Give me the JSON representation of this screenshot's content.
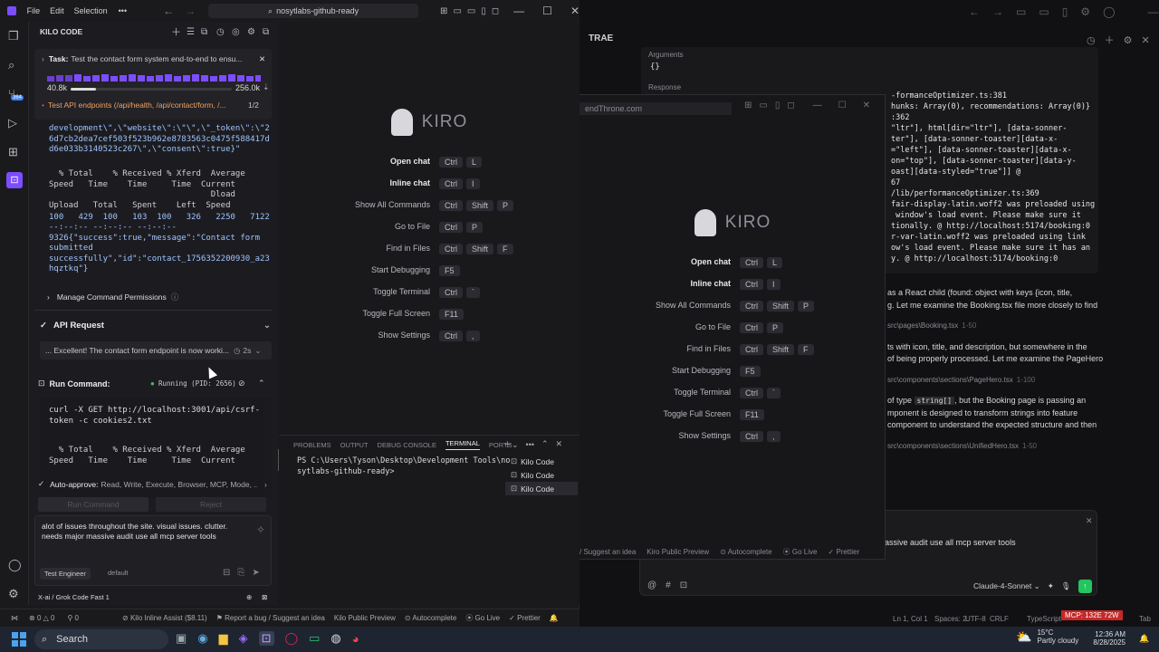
{
  "titlebar": {
    "menu": [
      "File",
      "Edit",
      "Selection"
    ],
    "more": "•••",
    "search": "nosytlabs-github-ready"
  },
  "kilo": {
    "header": "KILO CODE",
    "task_label": "Task:",
    "task_text": "Test the contact form system end-to-end to ensu...",
    "tokens_in": "40.8k",
    "tokens_max": "256.0k",
    "context_fraction": 0.16,
    "test_title": "Test API endpoints (/api/health, /api/contact/form, /...",
    "test_page": "1/2",
    "code1": "development\\\",\\\"website\\\":\\\"\\\",\\\"_token\\\":\\\"2\n6d7cb2dea7cef503f523b962e8783563c0475f588417d\nd6e033b3140523c267\\\",\\\"consent\\\":true}\"",
    "curl_hdr1": "  % Total    % Received % Xferd  Average\nSpeed   Time    Time     Time  Current\n                                 Dload\nUpload   Total   Spent    Left  Speed",
    "curl_stats": "100   429  100   103  100   326   2250   7122",
    "curl_body": "--:--:-- --:--:-- --:--:--\n9326{\"success\":true,\"message\":\"Contact form\nsubmitted\nsuccessfully\",\"id\":\"contact_1756352200930_a23\nhqztkq\"}",
    "manage_perms": "Manage Command Permissions",
    "api_request": "API Request",
    "excellent": "... Excellent! The contact form endpoint is now worki...",
    "excellent_time": "2s",
    "run_command": "Run Command:",
    "running": "Running (PID: 2656)",
    "cmd": "curl -X GET http://localhost:3001/api/csrf-\ntoken -c cookies2.txt",
    "curl_hdr2": "  % Total    % Received % Xferd  Average\nSpeed   Time    Time     Time  Current",
    "auto_approve_label": "Auto-approve:",
    "auto_approve_items": "Read, Write, Execute, Browser, MCP, Mode, ...",
    "run_cmd_btn": "Run Command",
    "reject_btn": "Reject",
    "input_text": "alot of issues throughout the site. visual issues. clutter.\nneeds major massive audit use all mcp server tools",
    "mode": "Test Engineer",
    "profile": "default",
    "model": "X-ai / Grok Code Fast 1"
  },
  "kiro_welcome": {
    "brand": "KIRO",
    "items": [
      {
        "label": "Open chat",
        "keys": [
          "Ctrl",
          "L"
        ],
        "bold": true
      },
      {
        "label": "Inline chat",
        "keys": [
          "Ctrl",
          "I"
        ],
        "bold": true
      },
      {
        "label": "Show All Commands",
        "keys": [
          "Ctrl",
          "Shift",
          "P"
        ]
      },
      {
        "label": "Go to File",
        "keys": [
          "Ctrl",
          "P"
        ]
      },
      {
        "label": "Find in Files",
        "keys": [
          "Ctrl",
          "Shift",
          "F"
        ]
      },
      {
        "label": "Start Debugging",
        "keys": [
          "F5"
        ]
      },
      {
        "label": "Toggle Terminal",
        "keys": [
          "Ctrl",
          "`"
        ]
      },
      {
        "label": "Toggle Full Screen",
        "keys": [
          "F11"
        ]
      },
      {
        "label": "Show Settings",
        "keys": [
          "Ctrl",
          ","
        ]
      }
    ]
  },
  "panel": {
    "tabs": [
      "PROBLEMS",
      "OUTPUT",
      "DEBUG CONSOLE",
      "TERMINAL",
      "PORTS"
    ],
    "active_tab": "TERMINAL",
    "terminal_text": "PS C:\\Users\\Tyson\\Desktop\\Development Tools\\no\nsytlabs-github-ready>",
    "terminals": [
      "Kilo Code",
      "Kilo Code",
      "Kilo Code"
    ]
  },
  "statusbar": {
    "errors": "0",
    "warnings": "0",
    "ports": "0",
    "inline_assist": "Kilo Inline Assist ($8.11)",
    "report": "Report a bug / Suggest an idea",
    "preview": "Kilo Public Preview",
    "autocomplete": "Autocomplete",
    "golive": "Go Live",
    "prettier": "Prettier"
  },
  "trae": {
    "title": "TRAE",
    "arguments_label": "Arguments",
    "arguments_value": "{}",
    "response_label": "Response",
    "tab_url": "endThrone.com",
    "log_lines": [
      "-formanceOptimizer.ts:381",
      "hunks: Array(0), recommendations: Array(0)}",
      ":362",
      "\"ltr\"], html[dir=\"ltr\"], [data-sonner-",
      "ter\"], [data-sonner-toaster][data-x-",
      "=\"left\"], [data-sonner-toaster][data-x-",
      "on=\"top\"], [data-sonner-toaster][data-y-",
      "oast][data-styled=\"true\"]] @",
      "67",
      "/lib/performanceOptimizer.ts:369",
      "fair-display-latin.woff2 was preloaded using",
      " window's load event. Please make sure it",
      "tionally. @ http://localhost:5174/booking:0",
      "r-var-latin.woff2 was preloaded using link",
      "ow's load event. Please make sure it has an",
      "y. @ http://localhost:5174/booking:0"
    ],
    "chat": [
      "as a React child (found: object with keys {icon, title,",
      "g. Let me examine the Booking.tsx file more closely to find"
    ],
    "file1": "src\\pages\\Booking.tsx",
    "file1_range": "1-50",
    "chat2": [
      "ts with icon, title, and description, but somewhere in the",
      "of being properly processed. Let me examine the PageHero"
    ],
    "file2": "src\\components\\sections\\PageHero.tsx",
    "file2_range": "1-100",
    "chat3_pre": "of type ",
    "chat3_code": "string[]",
    "chat3_post": ", but the Booking page is passing an",
    "chat3": [
      "mponent is designed to transform strings into feature",
      "component to understand the expected structure and then"
    ],
    "file3": "src\\components\\sections\\UnifiedHero.tsx",
    "file3_range": "1-50",
    "input_text": "assive audit use all mcp server tools",
    "model": "Claude-4-Sonnet",
    "status": {
      "pos": "Ln 1, Col 1",
      "spaces": "Spaces: 2",
      "enc": "UTF-8",
      "eol": "CRLF",
      "lang": "TypeScript",
      "mcp": "MCP: 132E 72W",
      "tab": "Tab"
    },
    "status_left": {
      "suggest": "/ Suggest an idea",
      "preview": "Kiro Public Preview",
      "autocomplete": "Autocomplete",
      "golive": "Go Live",
      "prettier": "Prettier"
    }
  },
  "taskbar": {
    "search": "Search",
    "weather_temp": "15°C",
    "weather_desc": "Partly cloudy",
    "time": "12:36 AM",
    "date": "8/28/2025"
  },
  "colors": {
    "accent": "#7c4dff",
    "running": "#3fbf5f",
    "trae_green": "#22c55e",
    "mcp_red": "#c62828"
  }
}
